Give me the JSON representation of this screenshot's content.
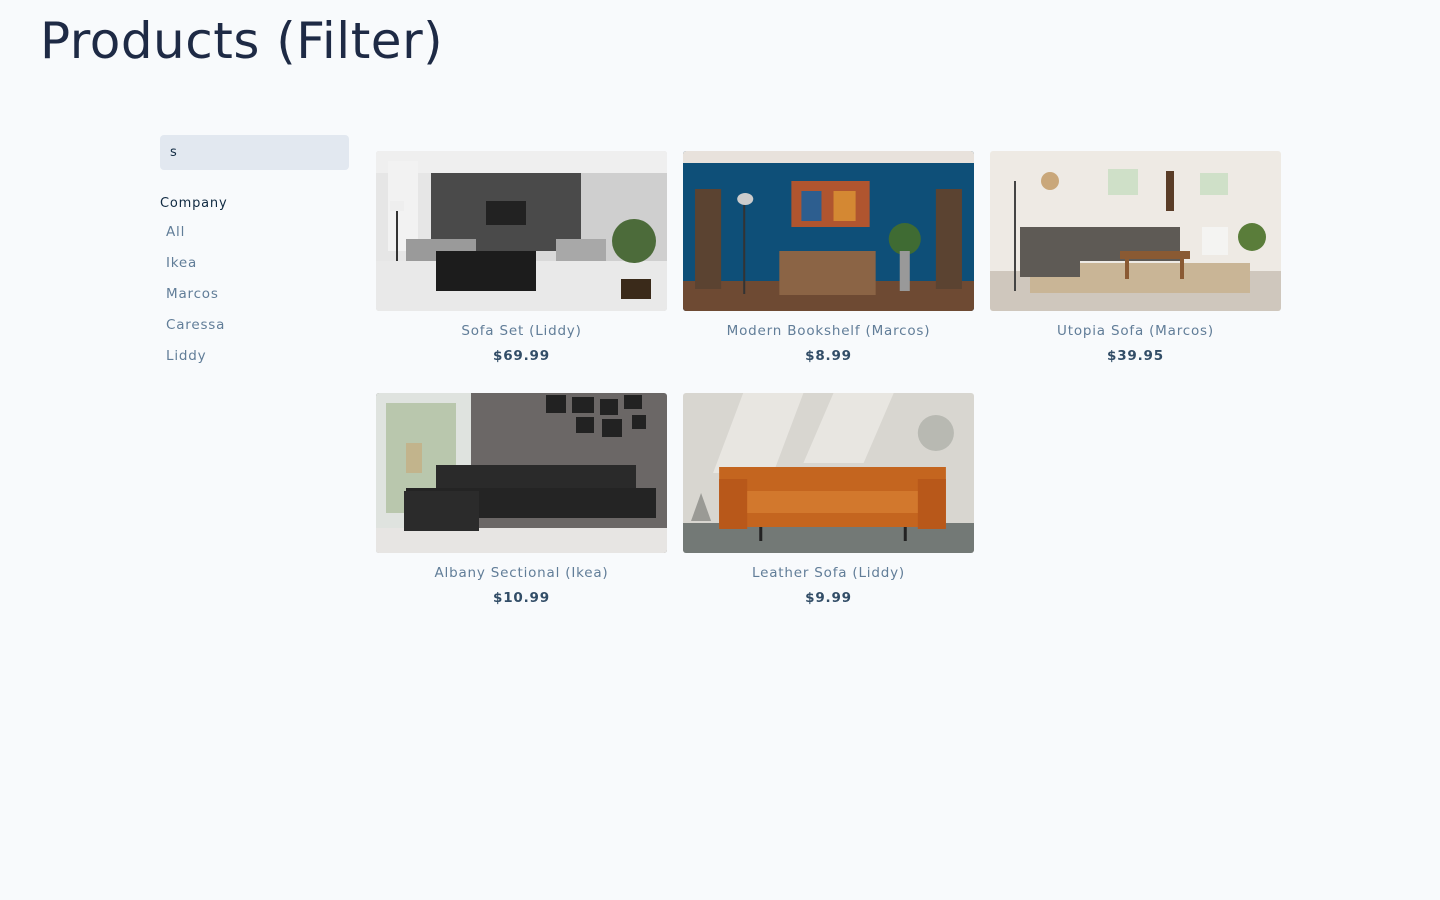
{
  "page": {
    "title": "Products (Filter)"
  },
  "filters": {
    "search": {
      "value": "s",
      "placeholder": "search"
    },
    "company_heading": "Company",
    "companies": [
      "All",
      "Ikea",
      "Marcos",
      "Caressa",
      "Liddy"
    ]
  },
  "products": [
    {
      "name": "Sofa Set (Liddy)",
      "price": "$69.99",
      "image": "modern-grey-living-room"
    },
    {
      "name": "Modern Bookshelf (Marcos)",
      "price": "$8.99",
      "image": "blue-wall-room-with-bookshelves"
    },
    {
      "name": "Utopia Sofa (Marcos)",
      "price": "$39.95",
      "image": "bright-living-room-with-sofa"
    },
    {
      "name": "Albany Sectional (Ikea)",
      "price": "$10.99",
      "image": "black-leather-sectional"
    },
    {
      "name": "Leather Sofa (Liddy)",
      "price": "$9.99",
      "image": "orange-leather-sofa"
    }
  ]
}
